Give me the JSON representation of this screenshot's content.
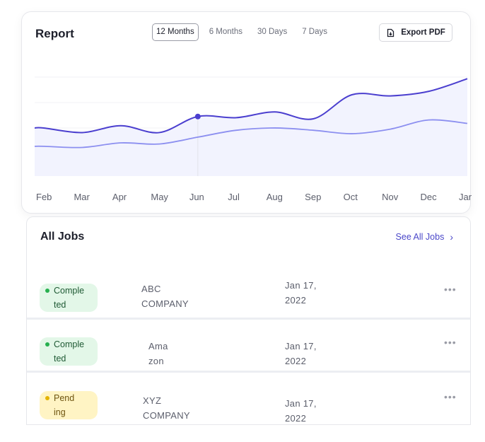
{
  "report": {
    "title": "Report",
    "tabs": [
      {
        "label": "12 Months",
        "active": true
      },
      {
        "label": "6 Months",
        "active": false
      },
      {
        "label": "30 Days",
        "active": false
      },
      {
        "label": "7 Days",
        "active": false
      }
    ],
    "export_label": "Export PDF",
    "export_icon": "file-download-icon"
  },
  "chart_data": {
    "type": "area",
    "categories": [
      "Feb",
      "Mar",
      "Apr",
      "May",
      "Jun",
      "Jul",
      "Aug",
      "Sep",
      "Oct",
      "Nov",
      "Dec",
      "Jan"
    ],
    "series": [
      {
        "color": "#4b3fcf",
        "values": [
          42,
          38,
          44,
          38,
          52,
          51,
          56,
          50,
          71,
          70,
          74,
          85
        ]
      },
      {
        "color": "#8c8ff0",
        "values": [
          26,
          25,
          29,
          28,
          34,
          40,
          42,
          40,
          37,
          41,
          49,
          46
        ]
      }
    ],
    "highlight_index": 4,
    "grid": true,
    "legend": "none",
    "xlabel": "",
    "ylabel": ""
  },
  "jobs": {
    "title": "All Jobs",
    "see_all_label": "See All Jobs",
    "rows": [
      {
        "status_line1": "Comple",
        "status_line2": "ted",
        "status_type": "completed",
        "company_line1": "ABC",
        "company_line2": "COMPANY",
        "date_line1": "Jan 17,",
        "date_line2": "2022",
        "more": "•••"
      },
      {
        "status_line1": "Comple",
        "status_line2": "ted",
        "status_type": "completed",
        "company_line1": "Ama",
        "company_line2": "zon",
        "date_line1": "Jan 17,",
        "date_line2": "2022",
        "more": "•••"
      },
      {
        "status_line1": "Pend",
        "status_line2": "ing",
        "status_type": "pending",
        "company_line1": "XYZ",
        "company_line2": "COMPANY",
        "date_line1": "Jan 17,",
        "date_line2": "2022",
        "more": "•••"
      }
    ]
  }
}
